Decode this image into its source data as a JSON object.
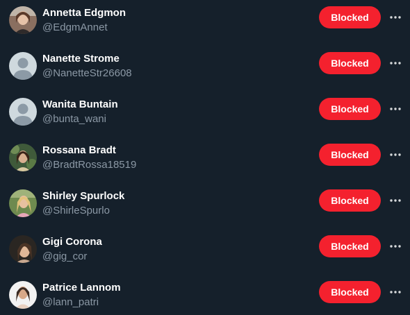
{
  "blocked_accounts": [
    {
      "name": "Annetta Edgmon",
      "handle": "@EdgmAnnet",
      "button_label": "Blocked",
      "avatar": "profile-photo"
    },
    {
      "name": "Nanette Strome",
      "handle": "@NanetteStr26608",
      "button_label": "Blocked",
      "avatar": "default-avatar"
    },
    {
      "name": "Wanita Buntain",
      "handle": "@bunta_wani",
      "button_label": "Blocked",
      "avatar": "default-avatar"
    },
    {
      "name": "Rossana Bradt",
      "handle": "@BradtRossa18519",
      "button_label": "Blocked",
      "avatar": "profile-photo"
    },
    {
      "name": "Shirley Spurlock",
      "handle": "@ShirleSpurlo",
      "button_label": "Blocked",
      "avatar": "profile-photo"
    },
    {
      "name": "Gigi Corona",
      "handle": "@gig_cor",
      "button_label": "Blocked",
      "avatar": "profile-photo"
    },
    {
      "name": "Patrice Lannom",
      "handle": "@lann_patri",
      "button_label": "Blocked",
      "avatar": "profile-photo"
    }
  ],
  "colors": {
    "background": "#15202b",
    "blocked_button": "#f4212e",
    "handle_text": "#8b98a5",
    "name_text": "#ffffff"
  },
  "icons": {
    "more_options": "more-options-icon",
    "default_avatar": "default-avatar-icon"
  }
}
